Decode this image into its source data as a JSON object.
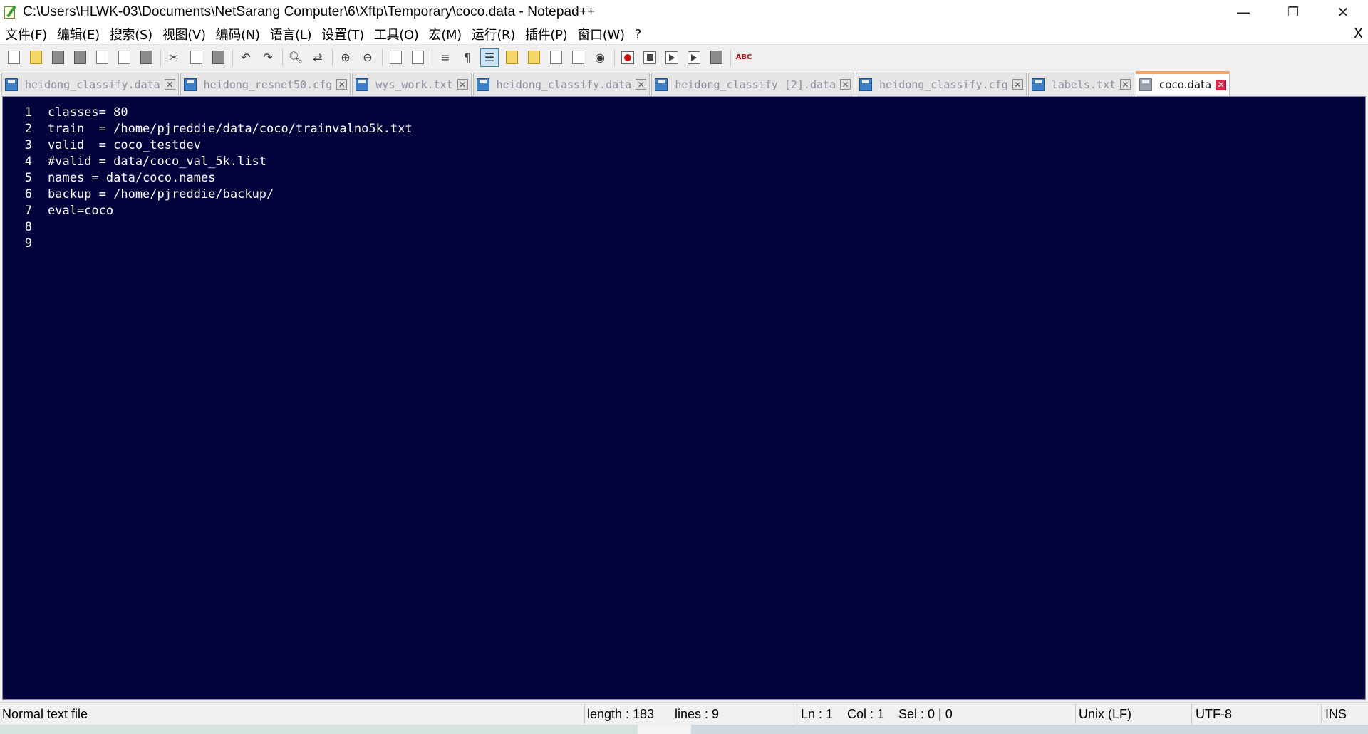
{
  "window": {
    "title": "C:\\Users\\HLWK-03\\Documents\\NetSarang Computer\\6\\Xftp\\Temporary\\coco.data - Notepad++",
    "minimize_glyph": "—",
    "restore_glyph": "❐",
    "close_glyph": "✕"
  },
  "menu": {
    "items": [
      "文件(F)",
      "编辑(E)",
      "搜索(S)",
      "视图(V)",
      "编码(N)",
      "语言(L)",
      "设置(T)",
      "工具(O)",
      "宏(M)",
      "运行(R)",
      "插件(P)",
      "窗口(W)",
      "?"
    ],
    "close_doc": "X"
  },
  "toolbar": {
    "icons": [
      "new-file-icon",
      "open-file-icon",
      "save-icon",
      "save-all-icon",
      "close-icon",
      "close-all-icon",
      "print-icon",
      "cut-icon",
      "copy-icon",
      "paste-icon",
      "undo-icon",
      "redo-icon",
      "find-icon",
      "replace-icon",
      "zoom-in-icon",
      "zoom-out-icon",
      "sync-vertical-icon",
      "sync-horizontal-icon",
      "word-wrap-icon",
      "show-all-chars-icon",
      "indent-guide-icon",
      "user-define-lang-icon",
      "doc-map-icon",
      "function-list-icon",
      "folder-workspace-icon",
      "monitoring-icon",
      "record-macro-icon",
      "stop-macro-icon",
      "play-macro-icon",
      "run-macro-multiple-icon",
      "save-macro-icon",
      "spell-check-icon"
    ],
    "spell_label": "ABC"
  },
  "tabs": [
    {
      "label": "heidong_classify.data",
      "active": false
    },
    {
      "label": "heidong_resnet50.cfg",
      "active": false
    },
    {
      "label": "wys_work.txt",
      "active": false
    },
    {
      "label": "heidong_classify.data",
      "active": false
    },
    {
      "label": "heidong_classify [2].data",
      "active": false
    },
    {
      "label": "heidong_classify.cfg",
      "active": false
    },
    {
      "label": "labels.txt",
      "active": false
    },
    {
      "label": "coco.data",
      "active": true
    }
  ],
  "tab_close_glyph": "✕",
  "editor": {
    "background": "#02023c",
    "text_color": "#ffffff",
    "line_numbers": [
      "1",
      "2",
      "3",
      "4",
      "5",
      "6",
      "7",
      "8",
      "9"
    ],
    "lines": [
      "classes= 80",
      "train  = /home/pjreddie/data/coco/trainvalno5k.txt",
      "valid  = coco_testdev",
      "#valid = data/coco_val_5k.list",
      "names = data/coco.names",
      "backup = /home/pjreddie/backup/",
      "eval=coco",
      "",
      ""
    ]
  },
  "status": {
    "file_type": "Normal text file",
    "length": "length : 183",
    "lines": "lines : 9",
    "ln": "Ln : 1",
    "col": "Col : 1",
    "sel": "Sel : 0 | 0",
    "eol": "Unix (LF)",
    "encoding": "UTF-8",
    "mode": "INS"
  }
}
